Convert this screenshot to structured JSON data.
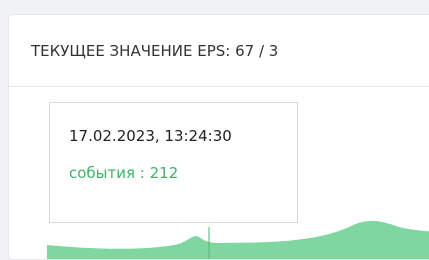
{
  "widget": {
    "title": "ТЕКУЩЕЕ ЗНАЧЕНИЕ EPS: 67 / 3"
  },
  "tooltip": {
    "timestamp": "17.02.2023, 13:24:30",
    "series_label": "события : 212"
  },
  "colors": {
    "area_fill": "#7fd6a0",
    "series_text": "#3bb36a",
    "crosshair": "#52b57c"
  }
}
